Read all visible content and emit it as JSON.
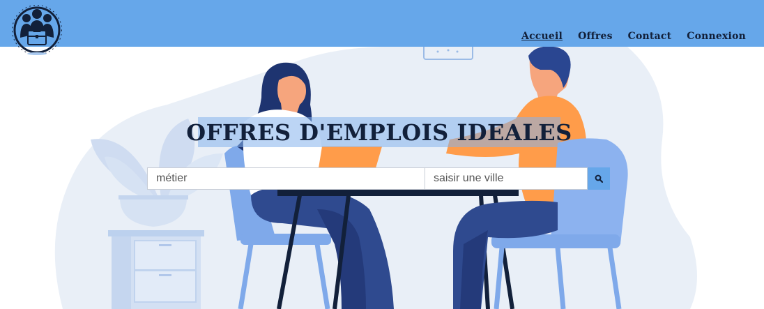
{
  "header": {
    "logo_icon": "briefcase-people-icon",
    "brand_color": "#66a7ea",
    "nav": [
      {
        "label": "Accueil",
        "active": true
      },
      {
        "label": "Offres",
        "active": false
      },
      {
        "label": "Contact",
        "active": false
      },
      {
        "label": "Connexion",
        "active": false
      }
    ]
  },
  "hero": {
    "title": "OFFRES D'EMPLOIS IDEALES",
    "illustration": "job-interview-illustration"
  },
  "search": {
    "job_placeholder": "métier",
    "city_placeholder": "saisir une ville",
    "button_icon": "search-icon"
  }
}
